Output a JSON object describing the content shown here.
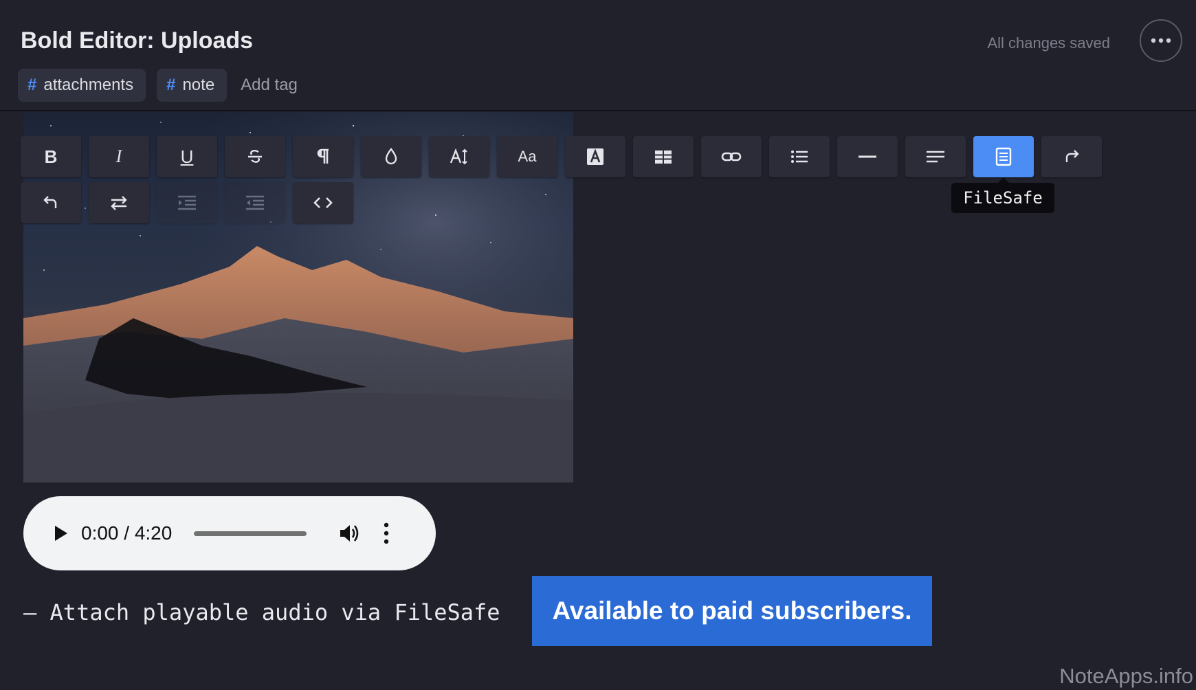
{
  "header": {
    "title": "Bold Editor: Uploads",
    "save_status": "All changes saved",
    "more_icon": "ellipsis-icon"
  },
  "tags": {
    "items": [
      {
        "label": "attachments"
      },
      {
        "label": "note"
      }
    ],
    "hash_symbol": "#",
    "add_placeholder": "Add tag"
  },
  "toolbar": {
    "row1": [
      "bold",
      "italic",
      "underline",
      "strikethrough",
      "paragraph",
      "text-color",
      "font-size",
      "font-family",
      "highlight",
      "table",
      "link",
      "list",
      "horizontal-rule",
      "align",
      "filesafe",
      "redo"
    ],
    "row2": [
      "undo",
      "text-direction",
      "indent",
      "outdent",
      "code-view"
    ],
    "labels": {
      "bold": "B",
      "italic": "I",
      "underline": "U",
      "font_family": "Aa"
    },
    "active": "filesafe",
    "tooltip": "FileSafe",
    "accent_color": "#4b8cf5"
  },
  "audio": {
    "time": "0:00 / 4:20"
  },
  "content": {
    "note_line": "– Attach playable audio via FileSafe",
    "banner": "Available to paid subscribers."
  },
  "watermark": "NoteApps.info"
}
